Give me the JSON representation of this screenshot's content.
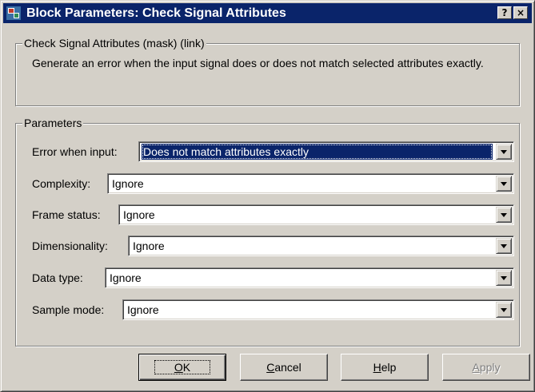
{
  "window": {
    "title": "Block Parameters: Check Signal Attributes",
    "help_glyph": "?",
    "close_glyph": "×",
    "icon": "simulink-block-icon"
  },
  "mask": {
    "legend": "Check Signal Attributes (mask) (link)",
    "description": "Generate an error when the input signal does or does not match selected attributes exactly."
  },
  "parameters": {
    "legend": "Parameters",
    "rows": [
      {
        "label": "Error when input:",
        "value": "Does not match attributes exactly",
        "selected": true
      },
      {
        "label": "Complexity:",
        "value": "Ignore"
      },
      {
        "label": "Frame status:",
        "value": "Ignore"
      },
      {
        "label": "Dimensionality:",
        "value": "Ignore"
      },
      {
        "label": "Data type:",
        "value": "Ignore"
      },
      {
        "label": "Sample mode:",
        "value": "Ignore"
      }
    ]
  },
  "buttons": {
    "ok": {
      "mnemonic": "O",
      "rest": "K"
    },
    "cancel": {
      "mnemonic": "C",
      "rest": "ancel"
    },
    "help": {
      "mnemonic": "H",
      "rest": "elp"
    },
    "apply": {
      "mnemonic": "A",
      "rest": "pply",
      "enabled": false
    }
  },
  "colors": {
    "titlebar": "#0a246a",
    "face": "#d4d0c8",
    "selection": "#0a246a"
  }
}
